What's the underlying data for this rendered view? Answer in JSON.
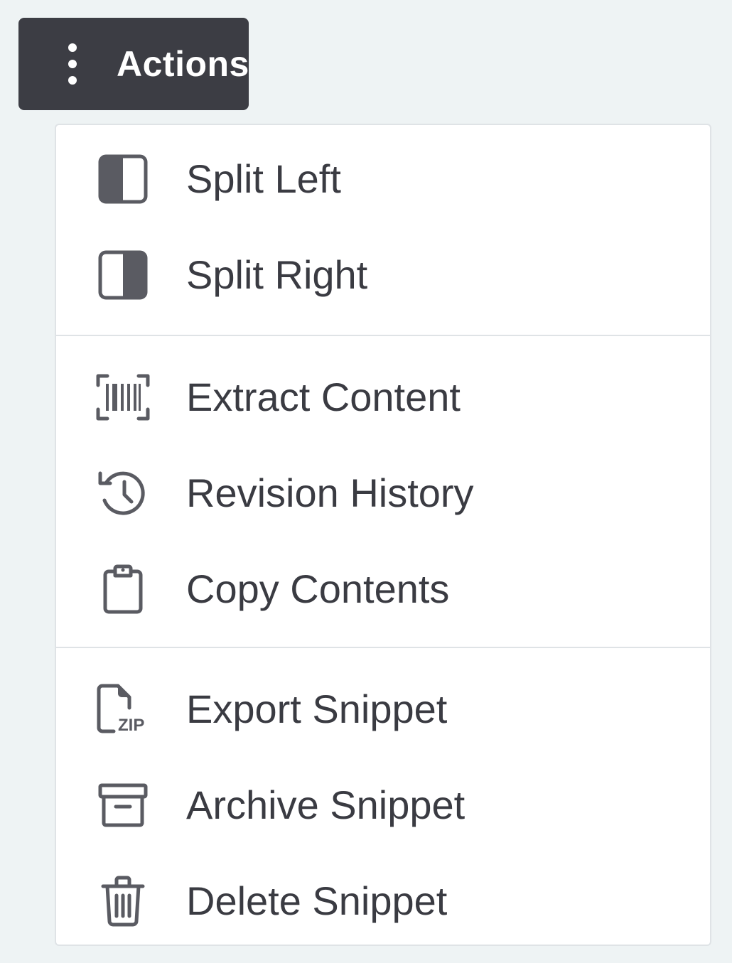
{
  "actions_button": {
    "label": "Actions",
    "icon": "kebab-vertical-icon"
  },
  "menu": {
    "groups": [
      {
        "items": [
          {
            "label": "Split Left",
            "icon": "split-left-icon"
          },
          {
            "label": "Split Right",
            "icon": "split-right-icon"
          }
        ]
      },
      {
        "items": [
          {
            "label": "Extract Content",
            "icon": "barcode-scan-icon"
          },
          {
            "label": "Revision History",
            "icon": "history-icon"
          },
          {
            "label": "Copy Contents",
            "icon": "clipboard-icon"
          }
        ]
      },
      {
        "items": [
          {
            "label": "Export Snippet",
            "icon": "zip-file-icon"
          },
          {
            "label": "Archive Snippet",
            "icon": "archive-box-icon"
          },
          {
            "label": "Delete Snippet",
            "icon": "trash-icon"
          }
        ]
      }
    ],
    "icon_color": "#5a5b62",
    "text_color": "#3a3b42"
  },
  "colors": {
    "button_bg": "#3c3d44",
    "page_bg": "#eef3f4",
    "menu_bg": "#ffffff",
    "divider": "#dfe3e6"
  }
}
